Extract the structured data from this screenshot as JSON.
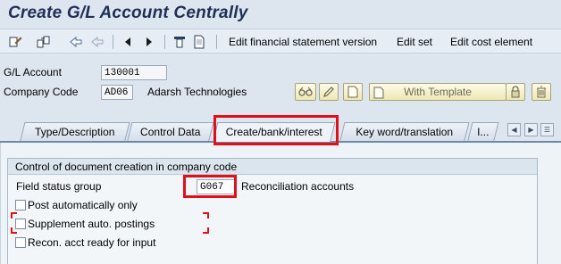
{
  "title": "Create G/L Account Centrally",
  "toolbar": {
    "icons": [
      "display-change-icon",
      "other-account-icon",
      "previous-icon",
      "next-icon",
      "first-icon",
      "prev-arrow-icon",
      "next-arrow-icon",
      "print-icon",
      "document-icon"
    ],
    "edit_fs_version": "Edit financial statement version",
    "edit_set": "Edit set",
    "edit_cost_element": "Edit cost element"
  },
  "header": {
    "gl_account_label": "G/L Account",
    "gl_account_value": "130001",
    "company_code_label": "Company Code",
    "company_code_value": "AD06",
    "company_name": "Adarsh Technologies",
    "with_template": "With Template"
  },
  "tabs": [
    {
      "label": "Type/Description"
    },
    {
      "label": "Control Data"
    },
    {
      "label": "Create/bank/interest"
    },
    {
      "label": "Key word/translation"
    },
    {
      "label": "I..."
    }
  ],
  "active_tab": "Create/bank/interest",
  "group": {
    "title": "Control of document creation in company code",
    "field_status_label": "Field status group",
    "field_status_value": "G067",
    "field_status_desc": "Reconciliation accounts",
    "checkboxes": [
      {
        "label": "Post automatically only",
        "checked": false
      },
      {
        "label": "Supplement auto. postings",
        "checked": false
      },
      {
        "label": "Recon. acct ready for input",
        "checked": false
      }
    ]
  },
  "colors": {
    "highlight": "#e0101a",
    "title": "#1f2f55"
  }
}
